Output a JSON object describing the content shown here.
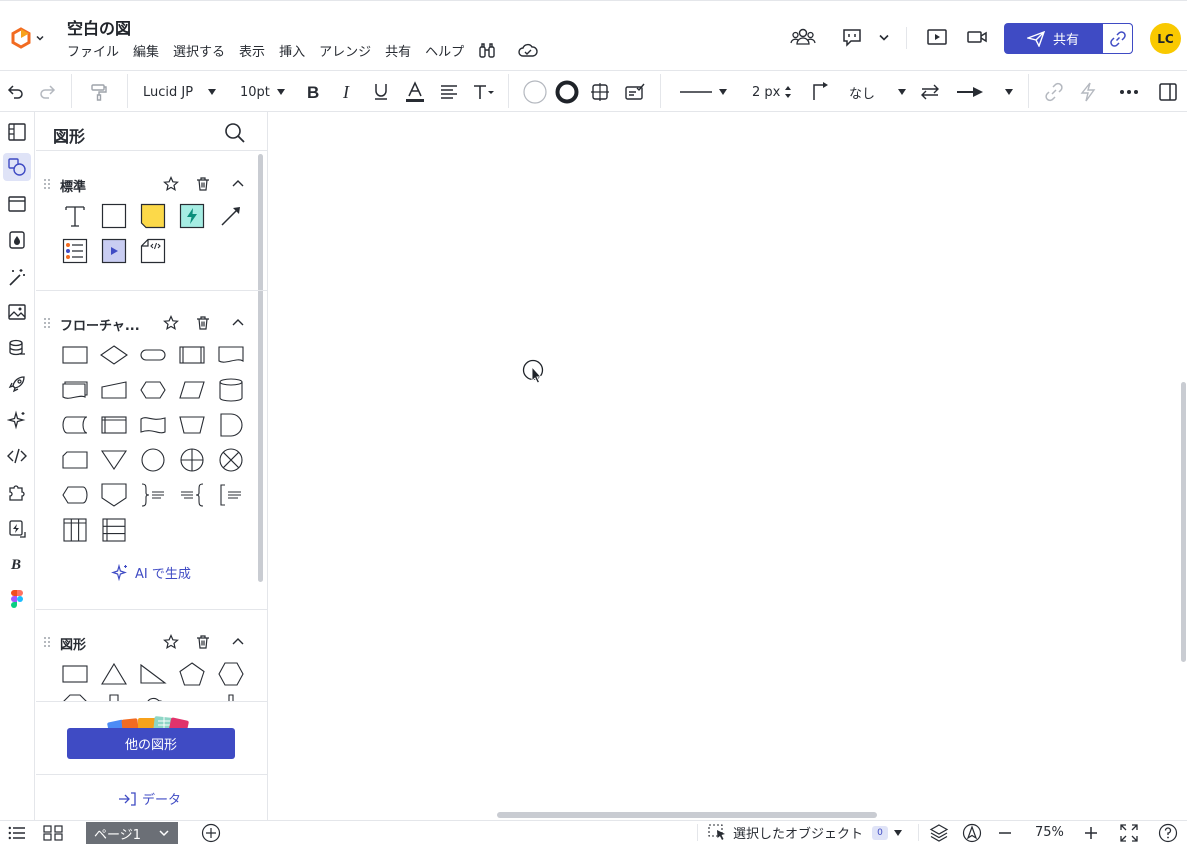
{
  "app": {
    "title": "空白の図"
  },
  "menu": [
    "ファイル",
    "編集",
    "選択する",
    "表示",
    "挿入",
    "アレンジ",
    "共有",
    "ヘルプ"
  ],
  "header": {
    "share_label": "共有",
    "avatar_initials": "LC"
  },
  "toolbar": {
    "font_family": "Lucid JP",
    "font_size": "10pt",
    "line_width": "2 px",
    "line_end": "なし"
  },
  "panel": {
    "title": "図形",
    "sections": [
      {
        "title": "標準"
      },
      {
        "title": "フローチャ..."
      },
      {
        "title": "図形"
      }
    ],
    "ai_generate_label": "AI で生成",
    "more_shapes_label": "他の図形",
    "data_label": "データ"
  },
  "bottombar": {
    "page_tab": "ページ1",
    "selected_objects_label": "選択したオブジェクト",
    "selected_count": "0",
    "zoom": "75%"
  },
  "colors": {
    "accent": "#3f4bc4",
    "avatar": "#f9c900",
    "logo": "#f26b21"
  }
}
